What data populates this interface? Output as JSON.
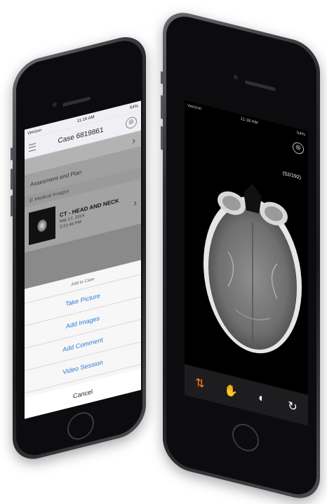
{
  "left_phone": {
    "status": {
      "carrier": "Verizon",
      "time": "11:19 AM",
      "battery": "54%"
    },
    "nav": {
      "title": "Case 6819861",
      "close_symbol": "⊗"
    },
    "rows": {
      "assessment": "Assesment and Plan",
      "chevron": "›"
    },
    "medical_images": {
      "section_label": "Medical Images",
      "title": "CT - HEAD AND NECK",
      "date": "Mar 17, 2014",
      "time": "2:21:46 PM"
    },
    "sheet": {
      "header": "Add to Case",
      "options": [
        "Take Picture",
        "Add Images",
        "Add Comment",
        "Video Session"
      ],
      "cancel": "Cancel"
    }
  },
  "right_phone": {
    "status": {
      "carrier": "Verizon",
      "time": "11:18 AM",
      "battery": "54%"
    },
    "close_symbol": "⊗",
    "counter": "(52/192)",
    "tools": {
      "scroll": "⇅",
      "pan": "✋",
      "contrast": "◐",
      "reset": "↻"
    },
    "accent_color": "#ff7a1a"
  }
}
